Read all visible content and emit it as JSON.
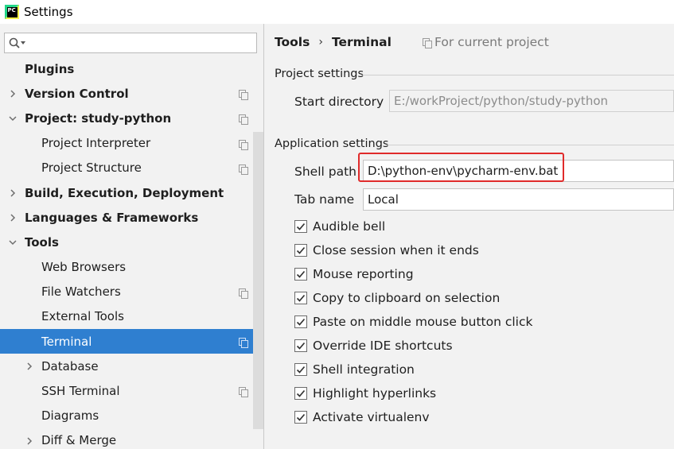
{
  "window": {
    "title": "Settings",
    "logo_text": "PC"
  },
  "search": {
    "placeholder": ""
  },
  "tree": [
    {
      "label": "Plugins",
      "bold": true,
      "indent": 0,
      "chevron": "none",
      "copy": false
    },
    {
      "label": "Version Control",
      "bold": true,
      "indent": 0,
      "chevron": "right",
      "copy": true
    },
    {
      "label": "Project: study-python",
      "bold": true,
      "indent": 0,
      "chevron": "down",
      "copy": true
    },
    {
      "label": "Project Interpreter",
      "bold": false,
      "indent": 1,
      "chevron": "none",
      "copy": true
    },
    {
      "label": "Project Structure",
      "bold": false,
      "indent": 1,
      "chevron": "none",
      "copy": true
    },
    {
      "label": "Build, Execution, Deployment",
      "bold": true,
      "indent": 0,
      "chevron": "right",
      "copy": false
    },
    {
      "label": "Languages & Frameworks",
      "bold": true,
      "indent": 0,
      "chevron": "right",
      "copy": false
    },
    {
      "label": "Tools",
      "bold": true,
      "indent": 0,
      "chevron": "down",
      "copy": false
    },
    {
      "label": "Web Browsers",
      "bold": false,
      "indent": 1,
      "chevron": "none",
      "copy": false
    },
    {
      "label": "File Watchers",
      "bold": false,
      "indent": 1,
      "chevron": "none",
      "copy": true
    },
    {
      "label": "External Tools",
      "bold": false,
      "indent": 1,
      "chevron": "none",
      "copy": false
    },
    {
      "label": "Terminal",
      "bold": false,
      "indent": 1,
      "chevron": "none",
      "copy": true,
      "selected": true
    },
    {
      "label": "Database",
      "bold": false,
      "indent": 1,
      "chevron": "right",
      "copy": false
    },
    {
      "label": "SSH Terminal",
      "bold": false,
      "indent": 1,
      "chevron": "none",
      "copy": true
    },
    {
      "label": "Diagrams",
      "bold": false,
      "indent": 1,
      "chevron": "none",
      "copy": false
    },
    {
      "label": "Diff & Merge",
      "bold": false,
      "indent": 1,
      "chevron": "right",
      "copy": false
    }
  ],
  "breadcrumb": {
    "parent": "Tools",
    "separator": "›",
    "current": "Terminal"
  },
  "scope": {
    "label": "For current project"
  },
  "project_settings": {
    "header": "Project settings",
    "start_directory_label": "Start directory",
    "start_directory_value": "E:/workProject/python/study-python"
  },
  "application_settings": {
    "header": "Application settings",
    "shell_path_label": "Shell path",
    "shell_path_value": "D:\\python-env\\pycharm-env.bat",
    "tab_name_label": "Tab name",
    "tab_name_value": "Local"
  },
  "checkboxes": [
    {
      "label": "Audible bell",
      "checked": true
    },
    {
      "label": "Close session when it ends",
      "checked": true
    },
    {
      "label": "Mouse reporting",
      "checked": true
    },
    {
      "label": "Copy to clipboard on selection",
      "checked": true
    },
    {
      "label": "Paste on middle mouse button click",
      "checked": true
    },
    {
      "label": "Override IDE shortcuts",
      "checked": true
    },
    {
      "label": "Shell integration",
      "checked": true
    },
    {
      "label": "Highlight hyperlinks",
      "checked": true
    },
    {
      "label": "Activate virtualenv",
      "checked": true
    }
  ],
  "colors": {
    "selection": "#2f7fd0",
    "highlight": "#e02b2b"
  }
}
